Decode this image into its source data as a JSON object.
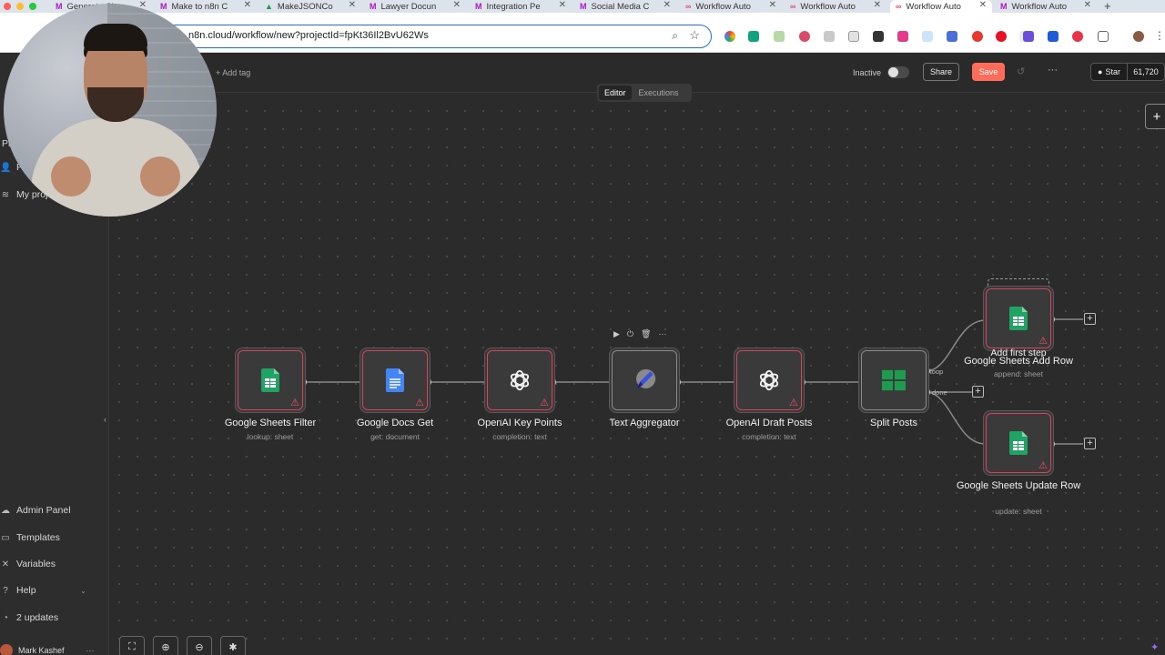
{
  "browser": {
    "tabs": [
      {
        "label": "Generate Ch",
        "icon": "make-icon"
      },
      {
        "label": "Make to n8n C",
        "icon": "make-icon"
      },
      {
        "label": "MakeJSONCo",
        "icon": "google-drive-icon"
      },
      {
        "label": "Lawyer Docun",
        "icon": "make-icon"
      },
      {
        "label": "Integration Pe",
        "icon": "make-icon"
      },
      {
        "label": "Social Media C",
        "icon": "make-icon"
      },
      {
        "label": "Workflow Auto",
        "icon": "n8n-icon"
      },
      {
        "label": "Workflow Auto",
        "icon": "n8n-icon"
      },
      {
        "label": "Workflow Auto",
        "icon": "n8n-icon",
        "active": true
      },
      {
        "label": "Workflow Auto",
        "icon": "make-icon"
      }
    ],
    "url": "n8n.cloud/workflow/new?projectId=fpKt36Il2BvU62Ws"
  },
  "sidebar": {
    "items": [
      {
        "label": "Pe",
        "icon": "user-icon"
      },
      {
        "label": "My project",
        "icon": "layers-icon"
      }
    ],
    "partial_label": "Pr",
    "bottom_items": [
      {
        "label": "Admin Panel",
        "icon": "cloud-icon"
      },
      {
        "label": "Templates",
        "icon": "templates-icon"
      },
      {
        "label": "Variables",
        "icon": "variables-icon"
      },
      {
        "label": "Help",
        "icon": "help-icon"
      },
      {
        "label": "2 updates",
        "icon": "update-icon"
      }
    ],
    "user_name": "Mark Kashef"
  },
  "header": {
    "add_tag": "+ Add tag",
    "status_label": "Inactive",
    "share_label": "Share",
    "save_label": "Save",
    "github_star_label": "Star",
    "github_star_count": "61,720"
  },
  "mode_switch": {
    "editor": "Editor",
    "executions": "Executions"
  },
  "workflow": {
    "nodes": [
      {
        "title": "Google Sheets Filter",
        "subtitle": "lookup: sheet",
        "icon": "google-sheets-icon",
        "warning": true
      },
      {
        "title": "Google Docs Get",
        "subtitle": "get: document",
        "icon": "google-docs-icon",
        "warning": true
      },
      {
        "title": "OpenAI Key Points",
        "subtitle": "completion: text",
        "icon": "openai-icon",
        "warning": true
      },
      {
        "title": "Text Aggregator",
        "subtitle": "",
        "icon": "pencil-icon",
        "warning": false
      },
      {
        "title": "OpenAI Draft Posts",
        "subtitle": "completion: text",
        "icon": "openai-icon",
        "warning": true
      },
      {
        "title": "Split Posts",
        "subtitle": "",
        "icon": "split-grid-icon",
        "warning": false
      },
      {
        "title": "Google Sheets Add Row",
        "subtitle": "append: sheet",
        "icon": "google-sheets-icon",
        "warning": true
      },
      {
        "title": "Google Sheets Update Row",
        "subtitle": "update: sheet",
        "icon": "google-sheets-icon",
        "warning": true
      }
    ],
    "edge_labels": {
      "loop": "loop",
      "done": "done"
    },
    "add_first_step": "Add first step"
  },
  "colors": {
    "accent": "#ff6d5a",
    "node_error_border": "#d9415e",
    "sheets_green": "#1fa463",
    "docs_blue": "#4285f4"
  }
}
